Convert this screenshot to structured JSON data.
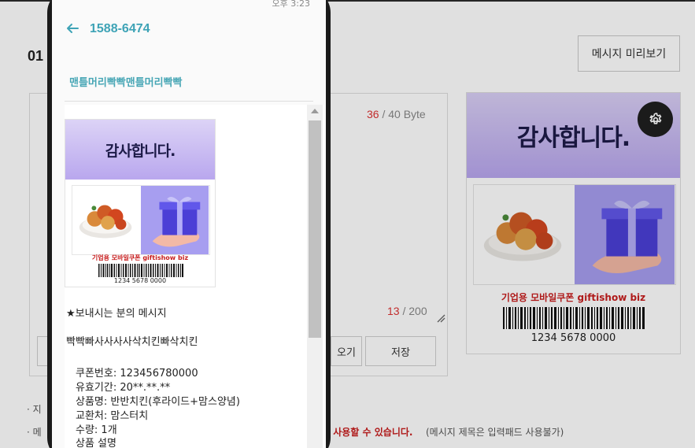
{
  "background_page": {
    "section_number": "01",
    "preview_button": "메시지 미리보기",
    "byte_counter": {
      "current": "36",
      "rest": " / 40 Byte"
    },
    "char_counter": {
      "current": "13",
      "rest": " / 200"
    },
    "buttons": {
      "load_partial": "오기",
      "save": "저장"
    },
    "preview_card": {
      "header": "감사합니다.",
      "brand": "기업용 모바일쿠폰  giftishow biz",
      "barcode_number": "1234 5678 0000"
    },
    "notes": {
      "line1_prefix": "· 지",
      "line2_prefix": "· 메",
      "line2_red": "여 사용할 수 있습니다.",
      "line2_gray": "(메시지 제목은 입력패드 사용불가)"
    }
  },
  "phone": {
    "status_time": "오후 3:23",
    "sender_number": "1588-6474",
    "sender_name": "맨틀머리빡빡맨틀머리빡빡",
    "coupon": {
      "header": "감사합니다.",
      "brand": "기업용 모바일쿠폰  giftishow biz",
      "barcode_number": "1234 5678 0000"
    },
    "message": {
      "intro": "★보내시는 분의 메시지",
      "body": "빡빡빠사사사사삭치킨빠삭치킨",
      "details": [
        "쿠폰번호: 123456780000",
        "유효기간: 20**.**.**",
        "상품명: 반반치킨(후라이드+맘스양념)",
        "교환처: 맘스터치",
        "수량: 1개",
        "상품 설명"
      ]
    }
  },
  "colors": {
    "accent_teal": "#3ea3b6",
    "counter_red": "#d33333",
    "coupon_purple": "#b9a7ee",
    "brand_red": "#c81e1e"
  }
}
